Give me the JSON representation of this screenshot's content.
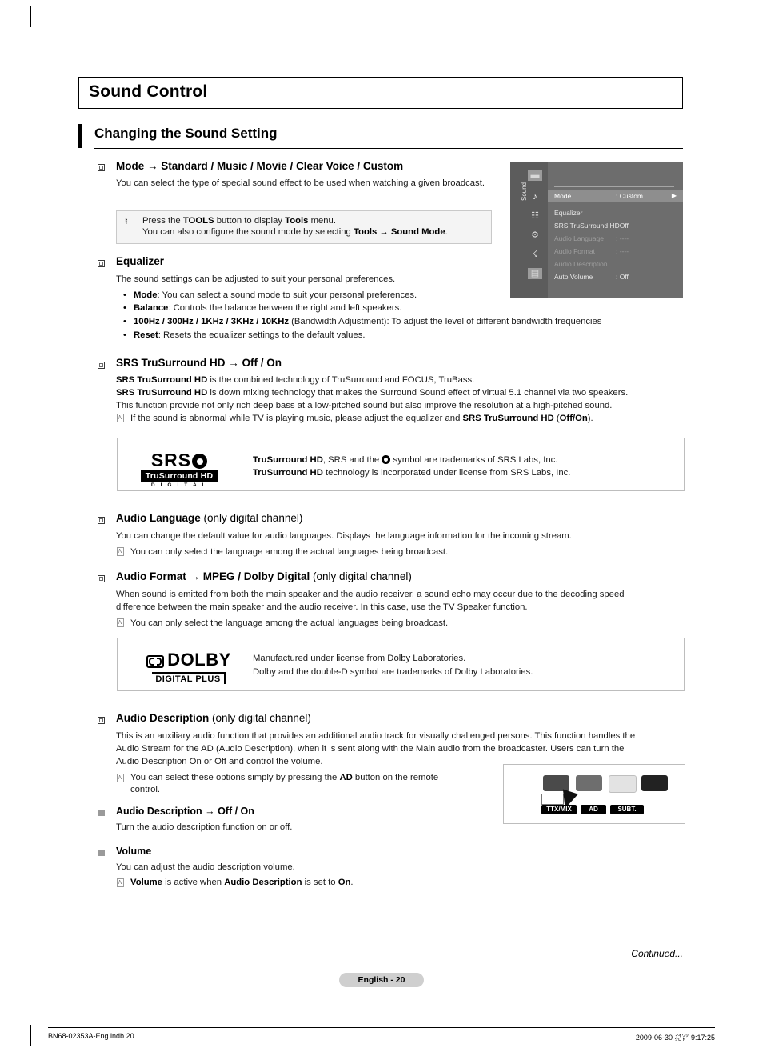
{
  "page": {
    "title": "Sound Control",
    "section_title": "Changing the Sound Setting",
    "page_label": "English - 20",
    "continued": "Continued...",
    "footer_left": "BN68-02353A-Eng.indb   20",
    "footer_right": "2009-06-30   ㍃㍗ 9:17:25"
  },
  "mode": {
    "heading_bold": "Mode",
    "heading_rest": "→ Standard / Music / Movie / Clear Voice / Custom",
    "body": "You can select the type of special sound effect to be used when watching a given broadcast.",
    "note_line1_pre": "Press the ",
    "note_line1_b1": "TOOLS",
    "note_line1_mid": " button to display ",
    "note_line1_b2": "Tools",
    "note_line1_post": " menu.",
    "note_line2_pre": "You can also configure the sound mode by selecting ",
    "note_line2_b1": "Tools → Sound Mode",
    "note_line2_post": "."
  },
  "osd": {
    "side_label": "Sound",
    "rows": [
      {
        "label": "Mode",
        "value": ": Custom",
        "state": "selected",
        "arrow": "▶"
      },
      {
        "label": "Equalizer",
        "value": "",
        "state": "normal",
        "arrow": ""
      },
      {
        "label": "SRS TruSurround HD",
        "value": ": Off",
        "state": "normal",
        "arrow": ""
      },
      {
        "label": "Audio Language",
        "value": ": ----",
        "state": "dim",
        "arrow": ""
      },
      {
        "label": "Audio Format",
        "value": ": ----",
        "state": "dim",
        "arrow": ""
      },
      {
        "label": "Audio Description",
        "value": "",
        "state": "dim",
        "arrow": ""
      },
      {
        "label": "Auto Volume",
        "value": ": Off",
        "state": "normal",
        "arrow": ""
      }
    ],
    "icons": [
      "picture-icon",
      "sound-icon",
      "channel-icon",
      "setup-icon",
      "input-icon",
      "support-icon"
    ]
  },
  "equalizer": {
    "heading": "Equalizer",
    "body": "The sound settings can be adjusted to suit your personal preferences.",
    "bullets": [
      {
        "bold": "Mode",
        "rest": ": You can select a sound mode to suit your personal preferences."
      },
      {
        "bold": "Balance",
        "rest": ": Controls the balance between the right and left speakers."
      },
      {
        "bold": "100Hz / 300Hz / 1KHz / 3KHz / 10KHz",
        "rest": " (Bandwidth Adjustment): To adjust the level of different bandwidth frequencies"
      },
      {
        "bold": "Reset",
        "rest": ": Resets the equalizer settings to the default values."
      }
    ]
  },
  "srs": {
    "heading_bold": "SRS TruSurround HD",
    "heading_rest": "→ Off / On",
    "line1_b": "SRS TruSurround HD",
    "line1_rest": " is the combined technology of TruSurround and FOCUS, TruBass.",
    "line2_b": "SRS TruSurround HD",
    "line2_rest": " is down mixing technology that makes the Surround Sound effect of virtual 5.1 channel via two speakers.",
    "line3": "This function provide not only rich deep bass at a low-pitched sound but also improve the resolution at a high-pitched sound.",
    "note_pre": "If the sound is abnormal while TV is playing music, please adjust the equalizer and ",
    "note_b1": "SRS TruSurround HD",
    "note_mid": " (",
    "note_b2": "Off/On",
    "note_post": ").",
    "logo_top": "SRS",
    "logo_band": "TruSurround HD",
    "logo_digital": "D I G I T A L",
    "legal_line1_b": "TruSurround HD",
    "legal_line1_mid": ", SRS and the ",
    "legal_line1_post": " symbol are trademarks of SRS Labs, Inc.",
    "legal_line2_b": "TruSurround HD",
    "legal_line2_rest": " technology is incorporated under license from SRS Labs, Inc."
  },
  "audio_language": {
    "heading_bold": "Audio Language",
    "heading_rest": "(only digital channel)",
    "body": "You can change the default value for audio languages. Displays the language information for the incoming stream.",
    "note": "You can only select the language among the actual languages being broadcast."
  },
  "audio_format": {
    "heading_bold": "Audio Format",
    "heading_mid": "→ MPEG / Dolby Digital",
    "heading_rest": "(only digital channel)",
    "body_line1": "When sound is emitted from both the main speaker and the audio receiver, a sound echo may occur due to the decoding speed",
    "body_line2": "difference between the main speaker and the audio receiver. In this case, use the TV Speaker function.",
    "note": "You can only select the language among the actual languages being broadcast.",
    "dolby_word": "DOLBY",
    "dolby_sub": "DIGITAL PLUS",
    "legal_line1": "Manufactured under license from Dolby Laboratories.",
    "legal_line2": "Dolby and the double-D symbol are trademarks of Dolby Laboratories."
  },
  "audio_description": {
    "heading_bold": "Audio Description",
    "heading_rest": "(only digital channel)",
    "body_line1": "This is an auxiliary audio function that provides an additional audio track for visually challenged persons. This function handles the",
    "body_line2": "Audio Stream for the AD (Audio Description), when it is sent along with the Main audio from the broadcaster. Users can turn the",
    "body_line3": "Audio Description On or Off and control the volume.",
    "note_pre": "You can select these options simply by pressing the ",
    "note_b": "AD",
    "note_post": " button on the remote",
    "note_line2": "control.",
    "sub1_bold": "Audio Description → Off / On",
    "sub1_body": "Turn the audio description function on or off.",
    "sub2_bold": "Volume",
    "sub2_body": "You can adjust the audio description volume.",
    "sub2_note_b1": "Volume",
    "sub2_note_mid": " is active when ",
    "sub2_note_b2": "Audio Description",
    "sub2_note_mid2": " is set to ",
    "sub2_note_b3": "On",
    "sub2_note_post": "."
  },
  "remote": {
    "buttons": [
      "TTX/MIX",
      "AD",
      "SUBT."
    ]
  }
}
